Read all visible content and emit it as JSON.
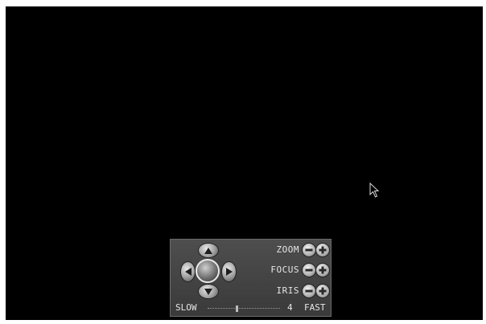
{
  "ptz_panel": {
    "zoom_label": "ZOOM",
    "focus_label": "FOCUS",
    "iris_label": "IRIS",
    "speed": {
      "slow_label": "SLOW",
      "fast_label": "FAST",
      "value": "4",
      "level": 0.4
    }
  },
  "icons": [
    "up-arrow-icon",
    "down-arrow-icon",
    "left-arrow-icon",
    "right-arrow-icon",
    "minus-icon",
    "plus-icon",
    "mouse-pointer-icon"
  ],
  "colors": {
    "screen": "#000000",
    "panel": "#464646",
    "label_text": "#e6e6e6"
  }
}
